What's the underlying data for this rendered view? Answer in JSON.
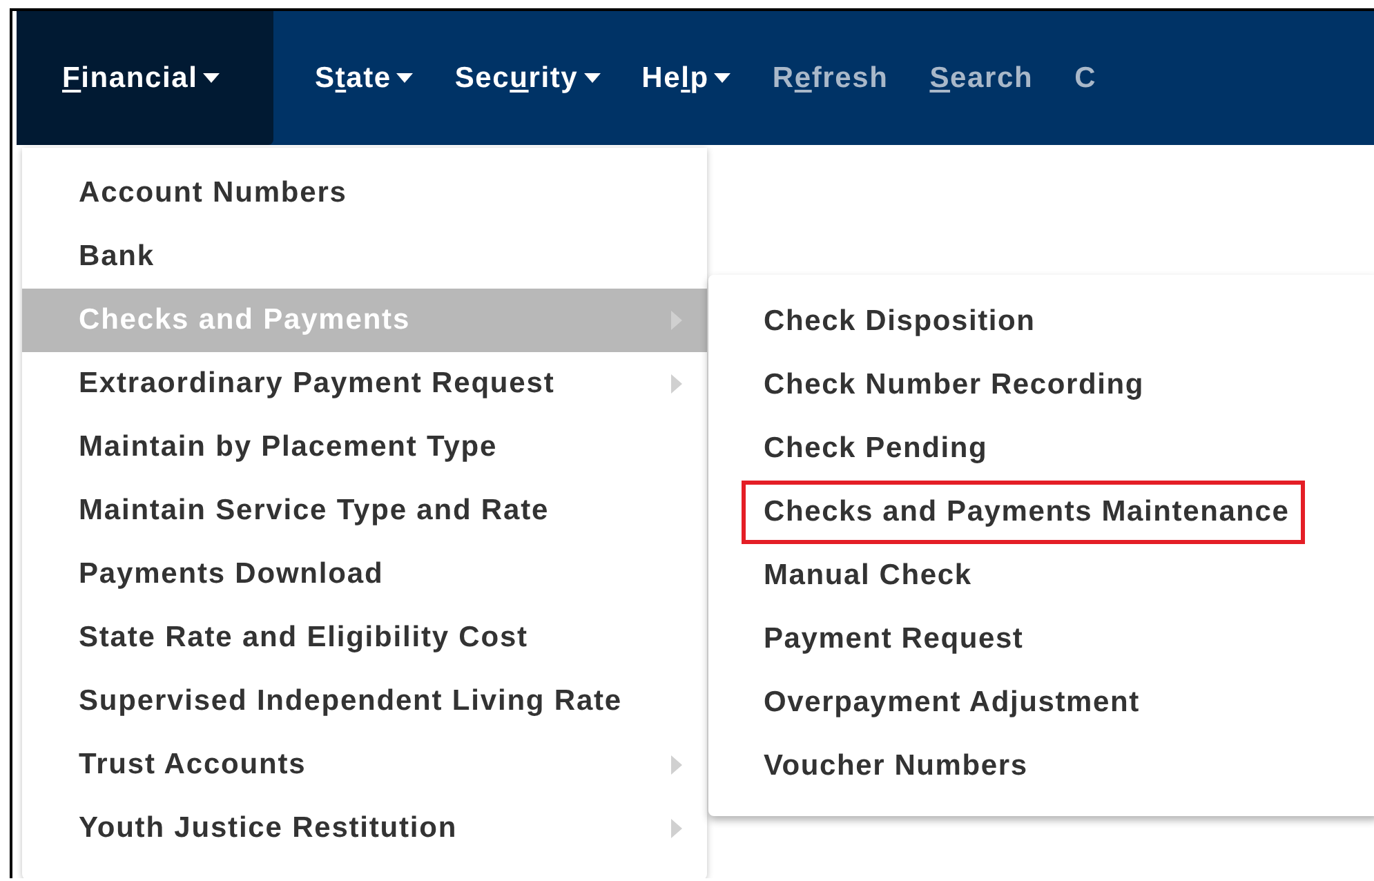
{
  "menu_bar": [
    {
      "kind": "dropdown",
      "selected": true,
      "access_key": "F",
      "after": "inancial"
    },
    {
      "kind": "dropdown",
      "selected": false,
      "before": "S",
      "access_key": "t",
      "after": "ate"
    },
    {
      "kind": "dropdown",
      "selected": false,
      "before": "Sec",
      "access_key": "u",
      "after": "rity"
    },
    {
      "kind": "dropdown",
      "selected": false,
      "before": "He",
      "access_key": "l",
      "after": "p"
    },
    {
      "kind": "link",
      "selected": false,
      "before": "R",
      "access_key": "e",
      "after": "fresh"
    },
    {
      "kind": "link",
      "selected": false,
      "access_key": "S",
      "after": "earch"
    },
    {
      "kind": "link",
      "selected": false,
      "before": "C"
    }
  ],
  "menu": [
    {
      "label": "Account Numbers",
      "selected": false,
      "has_submenu": false
    },
    {
      "label": "Bank",
      "selected": false,
      "has_submenu": false
    },
    {
      "label": "Checks and Payments",
      "selected": true,
      "has_submenu": true
    },
    {
      "label": "Extraordinary Payment Request",
      "selected": false,
      "has_submenu": true
    },
    {
      "label": "Maintain by Placement Type",
      "selected": false,
      "has_submenu": false
    },
    {
      "label": "Maintain Service Type and Rate",
      "selected": false,
      "has_submenu": false
    },
    {
      "label": "Payments Download",
      "selected": false,
      "has_submenu": false
    },
    {
      "label": "State Rate and Eligibility Cost",
      "selected": false,
      "has_submenu": false
    },
    {
      "label": "Supervised Independent Living Rate",
      "selected": false,
      "has_submenu": false
    },
    {
      "label": "Trust Accounts",
      "selected": false,
      "has_submenu": true
    },
    {
      "label": "Youth Justice Restitution",
      "selected": false,
      "has_submenu": true
    }
  ],
  "submenu": [
    {
      "label": "Check Disposition",
      "highlighted": false
    },
    {
      "label": "Check Number Recording",
      "highlighted": false
    },
    {
      "label": "Check Pending",
      "highlighted": false
    },
    {
      "label": "Checks and Payments Maintenance",
      "highlighted": true
    },
    {
      "label": "Manual Check",
      "highlighted": false
    },
    {
      "label": "Payment Request",
      "highlighted": false
    },
    {
      "label": "Overpayment Adjustment",
      "highlighted": false
    },
    {
      "label": "Voucher Numbers",
      "highlighted": false
    }
  ]
}
